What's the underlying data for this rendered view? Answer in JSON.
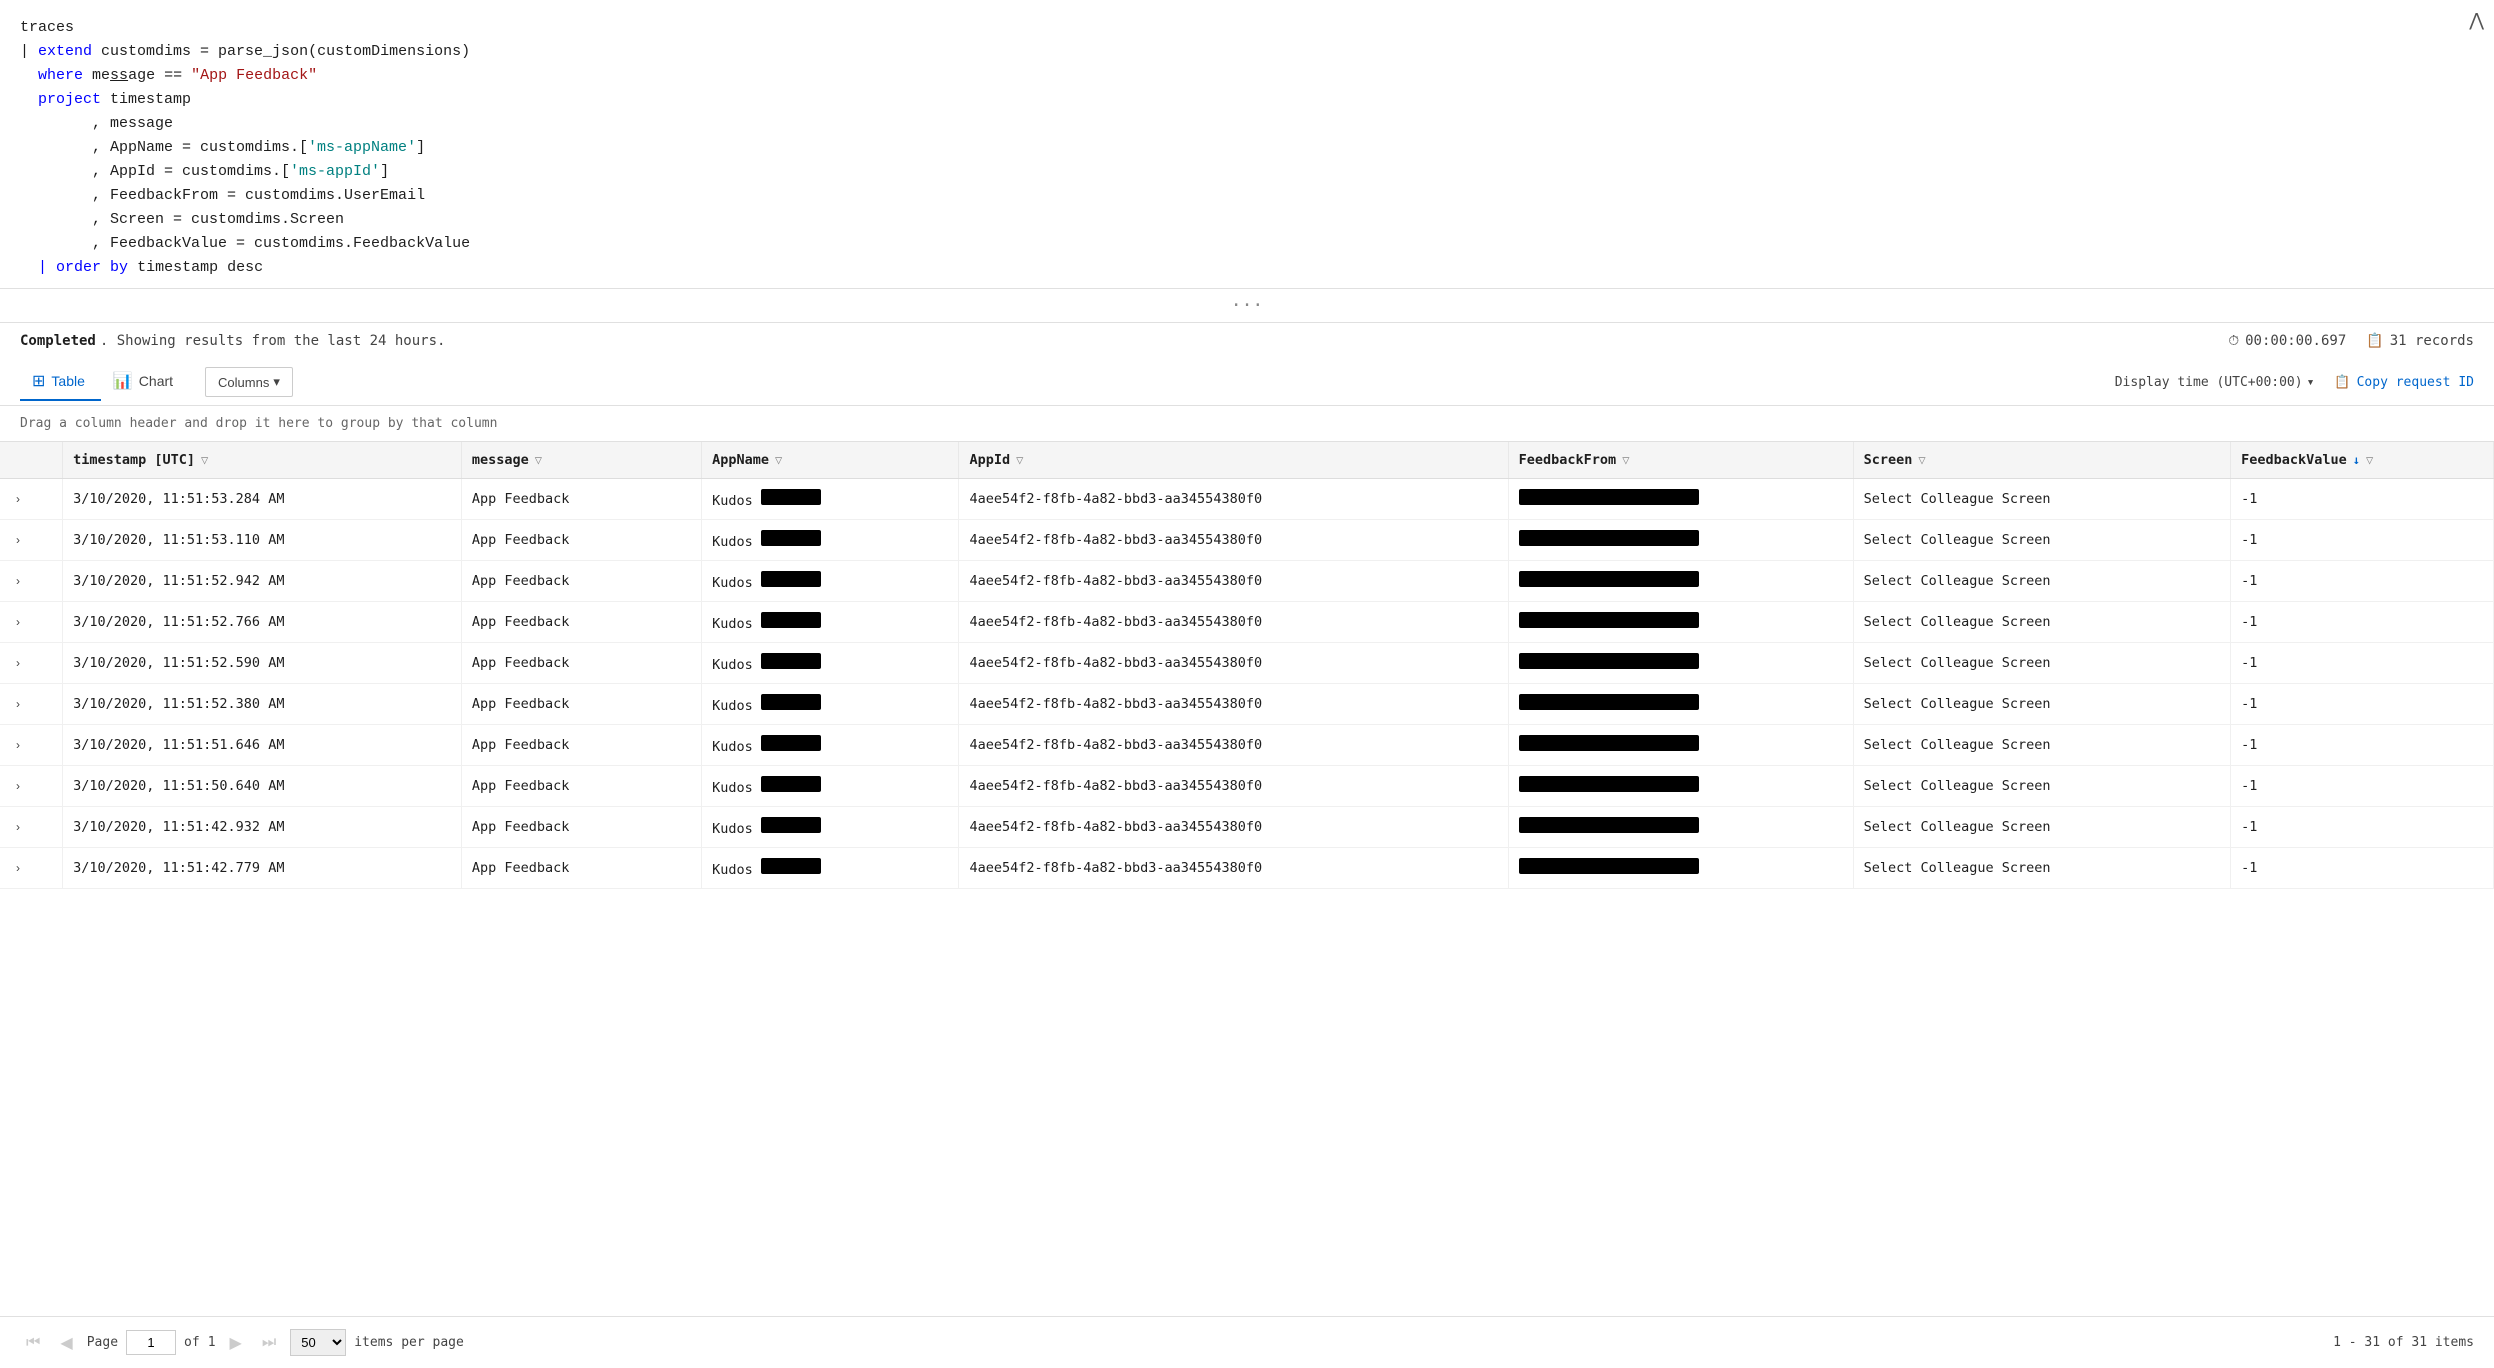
{
  "query": {
    "lines": [
      {
        "content": "traces",
        "type": "plain"
      },
      {
        "parts": [
          {
            "text": "| ",
            "type": "plain"
          },
          {
            "text": "extend",
            "type": "kw-blue"
          },
          {
            "text": " customdims = parse_json(customDimensions)",
            "type": "plain"
          }
        ]
      },
      {
        "parts": [
          {
            "text": "  ",
            "type": "plain"
          },
          {
            "text": "where",
            "type": "kw-blue"
          },
          {
            "text": " me",
            "type": "plain"
          },
          {
            "text": "ss",
            "type": "plain"
          },
          {
            "text": "age == ",
            "type": "plain"
          },
          {
            "text": "\"App Feedback\"",
            "type": "str-red"
          }
        ]
      },
      {
        "parts": [
          {
            "text": "  ",
            "type": "plain"
          },
          {
            "text": "project",
            "type": "kw-blue"
          },
          {
            "text": " timestamp",
            "type": "plain"
          }
        ]
      },
      {
        "parts": [
          {
            "text": "        , message",
            "type": "plain"
          }
        ]
      },
      {
        "parts": [
          {
            "text": "        , AppName = customdims.[",
            "type": "plain"
          },
          {
            "text": "'ms-appName'",
            "type": "str-teal"
          },
          {
            "text": "]",
            "type": "plain"
          }
        ]
      },
      {
        "parts": [
          {
            "text": "        , AppId = customdims.[",
            "type": "plain"
          },
          {
            "text": "'ms-appId'",
            "type": "str-teal"
          },
          {
            "text": "]",
            "type": "plain"
          }
        ]
      },
      {
        "parts": [
          {
            "text": "        , FeedbackFrom = customdims.UserEmail",
            "type": "plain"
          }
        ]
      },
      {
        "parts": [
          {
            "text": "        , Screen = customdims.Screen",
            "type": "plain"
          }
        ]
      },
      {
        "parts": [
          {
            "text": "        , FeedbackValue = customdims.FeedbackValue",
            "type": "plain"
          }
        ]
      },
      {
        "parts": [
          {
            "text": "  ",
            "type": "plain"
          },
          {
            "text": "| ",
            "type": "plain"
          },
          {
            "text": "order",
            "type": "kw-blue"
          },
          {
            "text": " ",
            "type": "plain"
          },
          {
            "text": "by",
            "type": "kw-blue"
          },
          {
            "text": " timestamp desc",
            "type": "plain"
          }
        ]
      }
    ]
  },
  "status": {
    "completed_text": "Completed",
    "showing_text": ". Showing results from the last 24 hours.",
    "time_label": "00:00:00.697",
    "records_label": "31 records"
  },
  "toolbar": {
    "table_tab": "Table",
    "chart_tab": "Chart",
    "columns_btn": "Columns",
    "display_time": "Display time (UTC+00:00)",
    "copy_request": "Copy request ID"
  },
  "drag_hint": "Drag a column header and drop it here to group by that column",
  "columns": [
    {
      "label": "timestamp [UTC]",
      "has_filter": true,
      "has_sort": false
    },
    {
      "label": "message",
      "has_filter": true,
      "has_sort": false
    },
    {
      "label": "AppName",
      "has_filter": true,
      "has_sort": false
    },
    {
      "label": "AppId",
      "has_filter": true,
      "has_sort": false
    },
    {
      "label": "FeedbackFrom",
      "has_filter": true,
      "has_sort": false
    },
    {
      "label": "Screen",
      "has_filter": true,
      "has_sort": false
    },
    {
      "label": "FeedbackValue",
      "has_filter": true,
      "has_sort": true,
      "sort_dir": "desc"
    }
  ],
  "rows": [
    {
      "timestamp": "3/10/2020, 11:51:53.284 AM",
      "message": "App Feedback",
      "appname": "Kudos",
      "appname_redacted": 60,
      "appid": "4aee54f2-f8fb-4a82-bbd3-aa34554380f0",
      "feedbackfrom_redacted": 180,
      "screen": "Select Colleague Screen",
      "feedbackvalue": "-1"
    },
    {
      "timestamp": "3/10/2020, 11:51:53.110 AM",
      "message": "App Feedback",
      "appname": "Kudos",
      "appname_redacted": 60,
      "appid": "4aee54f2-f8fb-4a82-bbd3-aa34554380f0",
      "feedbackfrom_redacted": 180,
      "screen": "Select Colleague Screen",
      "feedbackvalue": "-1"
    },
    {
      "timestamp": "3/10/2020, 11:51:52.942 AM",
      "message": "App Feedback",
      "appname": "Kudos",
      "appname_redacted": 60,
      "appid": "4aee54f2-f8fb-4a82-bbd3-aa34554380f0",
      "feedbackfrom_redacted": 180,
      "screen": "Select Colleague Screen",
      "feedbackvalue": "-1"
    },
    {
      "timestamp": "3/10/2020, 11:51:52.766 AM",
      "message": "App Feedback",
      "appname": "Kudos",
      "appname_redacted": 60,
      "appid": "4aee54f2-f8fb-4a82-bbd3-aa34554380f0",
      "feedbackfrom_redacted": 180,
      "screen": "Select Colleague Screen",
      "feedbackvalue": "-1"
    },
    {
      "timestamp": "3/10/2020, 11:51:52.590 AM",
      "message": "App Feedback",
      "appname": "Kudos",
      "appname_redacted": 60,
      "appid": "4aee54f2-f8fb-4a82-bbd3-aa34554380f0",
      "feedbackfrom_redacted": 180,
      "screen": "Select Colleague Screen",
      "feedbackvalue": "-1"
    },
    {
      "timestamp": "3/10/2020, 11:51:52.380 AM",
      "message": "App Feedback",
      "appname": "Kudos",
      "appname_redacted": 60,
      "appid": "4aee54f2-f8fb-4a82-bbd3-aa34554380f0",
      "feedbackfrom_redacted": 180,
      "screen": "Select Colleague Screen",
      "feedbackvalue": "-1"
    },
    {
      "timestamp": "3/10/2020, 11:51:51.646 AM",
      "message": "App Feedback",
      "appname": "Kudos",
      "appname_redacted": 60,
      "appid": "4aee54f2-f8fb-4a82-bbd3-aa34554380f0",
      "feedbackfrom_redacted": 180,
      "screen": "Select Colleague Screen",
      "feedbackvalue": "-1"
    },
    {
      "timestamp": "3/10/2020, 11:51:50.640 AM",
      "message": "App Feedback",
      "appname": "Kudos",
      "appname_redacted": 60,
      "appid": "4aee54f2-f8fb-4a82-bbd3-aa34554380f0",
      "feedbackfrom_redacted": 180,
      "screen": "Select Colleague Screen",
      "feedbackvalue": "-1"
    },
    {
      "timestamp": "3/10/2020, 11:51:42.932 AM",
      "message": "App Feedback",
      "appname": "Kudos",
      "appname_redacted": 60,
      "appid": "4aee54f2-f8fb-4a82-bbd3-aa34554380f0",
      "feedbackfrom_redacted": 180,
      "screen": "Select Colleague Screen",
      "feedbackvalue": "-1"
    },
    {
      "timestamp": "3/10/2020, 11:51:42.779 AM",
      "message": "App Feedback",
      "appname": "Kudos",
      "appname_redacted": 60,
      "appid": "4aee54f2-f8fb-4a82-bbd3-aa34554380f0",
      "feedbackfrom_redacted": 180,
      "screen": "Select Colleague Screen",
      "feedbackvalue": "-1"
    }
  ],
  "pagination": {
    "page_label": "Page",
    "current_page": "1",
    "of_label": "of",
    "total_pages": "1",
    "per_page": "50",
    "items_summary": "1 - 31 of 31 items"
  }
}
